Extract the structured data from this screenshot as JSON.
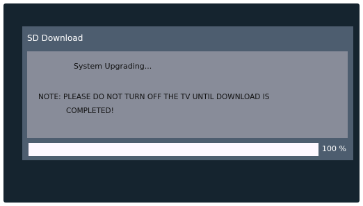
{
  "dialog": {
    "title": "SD Download",
    "status": "System Upgrading...",
    "note_line1": "NOTE: PLEASE DO NOT TURN OFF THE TV UNTIL DOWNLOAD IS",
    "note_line2": "COMPLETED!",
    "progress_value": 100,
    "progress_label": "100 %"
  },
  "colors": {
    "screen_background": "#15242f",
    "dialog_background": "#4d5d6f",
    "message_panel": "#888c99",
    "progress_fill": "#fdf7ff"
  }
}
